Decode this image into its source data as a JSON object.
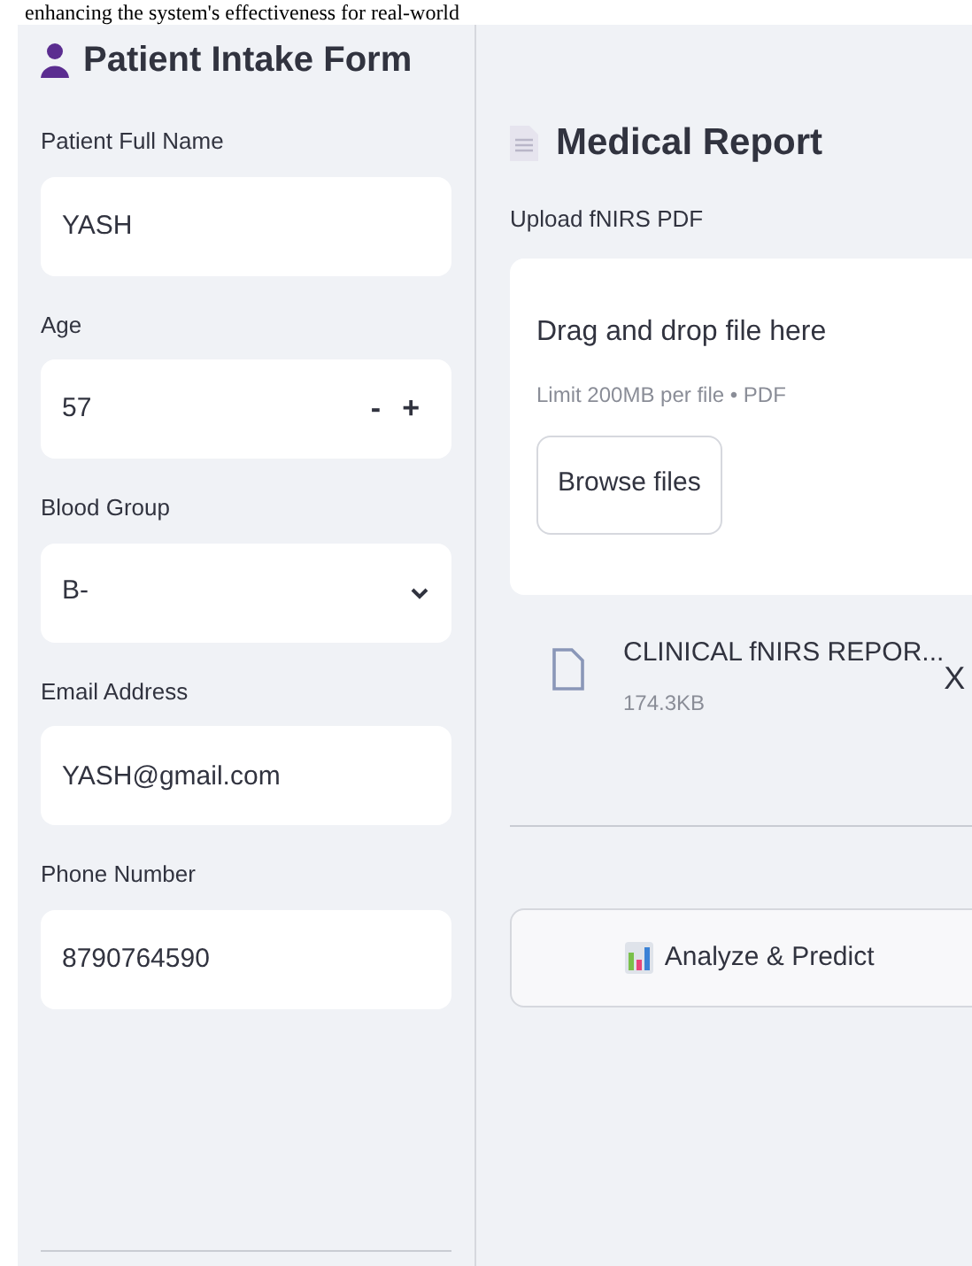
{
  "document_text": "enhancing the system's effectiveness for real-world",
  "intake_form": {
    "title": "Patient Intake Form",
    "fields": [
      {
        "kind": "text",
        "label": "Patient Full Name",
        "value": "YASH"
      },
      {
        "kind": "number",
        "label": "Age",
        "value": "57",
        "decrement": "-",
        "increment": "+"
      },
      {
        "kind": "select",
        "label": "Blood Group",
        "value": "B-"
      },
      {
        "kind": "text",
        "label": "Email Address",
        "value": "YASH@gmail.com"
      },
      {
        "kind": "text",
        "label": "Phone Number",
        "value": "8790764590"
      }
    ]
  },
  "medical_report": {
    "title": "Medical Report",
    "upload_label": "Upload fNIRS PDF",
    "dropzone": {
      "title": "Drag and drop file here",
      "hint": "Limit 200MB per file • PDF",
      "button": "Browse files"
    },
    "file": {
      "name": "CLINICAL fNIRS REPOR...",
      "size": "174.3KB",
      "remove": "X"
    },
    "analyze_button": "Analyze & Predict"
  }
}
